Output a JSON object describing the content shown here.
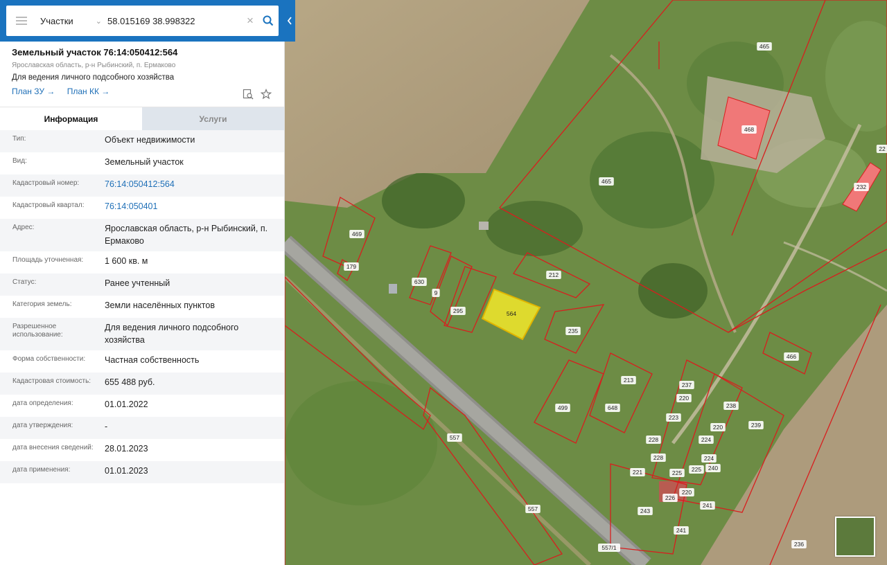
{
  "search": {
    "layer": "Участки",
    "query": "58.015169 38.998322"
  },
  "object": {
    "title": "Земельный участок 76:14:050412:564",
    "address": "Ярославская область, р-н Рыбинский, п. Ермаково",
    "use": "Для ведения личного подсобного хозяйства",
    "link_plan_zu": "План ЗУ →",
    "link_plan_kk": "План КК →"
  },
  "tabs": {
    "info": "Информация",
    "services": "Услуги"
  },
  "info_rows": [
    {
      "label": "Тип:",
      "value": "Объект недвижимости"
    },
    {
      "label": "Вид:",
      "value": "Земельный участок"
    },
    {
      "label": "Кадастровый номер:",
      "value": "76:14:050412:564"
    },
    {
      "label": "Кадастровый квартал:",
      "value": "76:14:050401"
    },
    {
      "label": "Адрес:",
      "value": "Ярославская область, р-н Рыбинский, п. Ермаково"
    },
    {
      "label": "Площадь уточненная:",
      "value": "1 600 кв. м"
    },
    {
      "label": "Статус:",
      "value": "Ранее учтенный"
    },
    {
      "label": "Категория земель:",
      "value": "Земли населённых пунктов"
    },
    {
      "label": "Разрешенное использование:",
      "value": "Для ведения личного подсобного хозяйства"
    },
    {
      "label": "Форма собственности:",
      "value": "Частная собственность"
    },
    {
      "label": "Кадастровая стоимость:",
      "value": "655 488 руб."
    },
    {
      "label": "дата определения:",
      "value": "01.01.2022"
    },
    {
      "label": "дата утверждения:",
      "value": "-"
    },
    {
      "label": "дата внесения сведений:",
      "value": "28.01.2023"
    },
    {
      "label": "дата применения:",
      "value": "01.01.2023"
    }
  ],
  "map": {
    "parcel_labels": [
      "465",
      "465",
      "468",
      "232",
      "22",
      "469",
      "179",
      "630",
      "9",
      "295",
      "564",
      "212",
      "235",
      "466",
      "213",
      "237",
      "238",
      "220",
      "223",
      "220",
      "239",
      "499",
      "648",
      "228",
      "224",
      "228",
      "224",
      "221",
      "225",
      "225",
      "240",
      "226",
      "220",
      "243",
      "241",
      "241",
      "557",
      "557",
      "557/1",
      "236"
    ],
    "selected_parcel": "564",
    "colors": {
      "boundary": "#d81e1e",
      "selected_fill": "#f2e72a",
      "building_fill": "#f07878",
      "accent": "#1a73bf"
    }
  }
}
